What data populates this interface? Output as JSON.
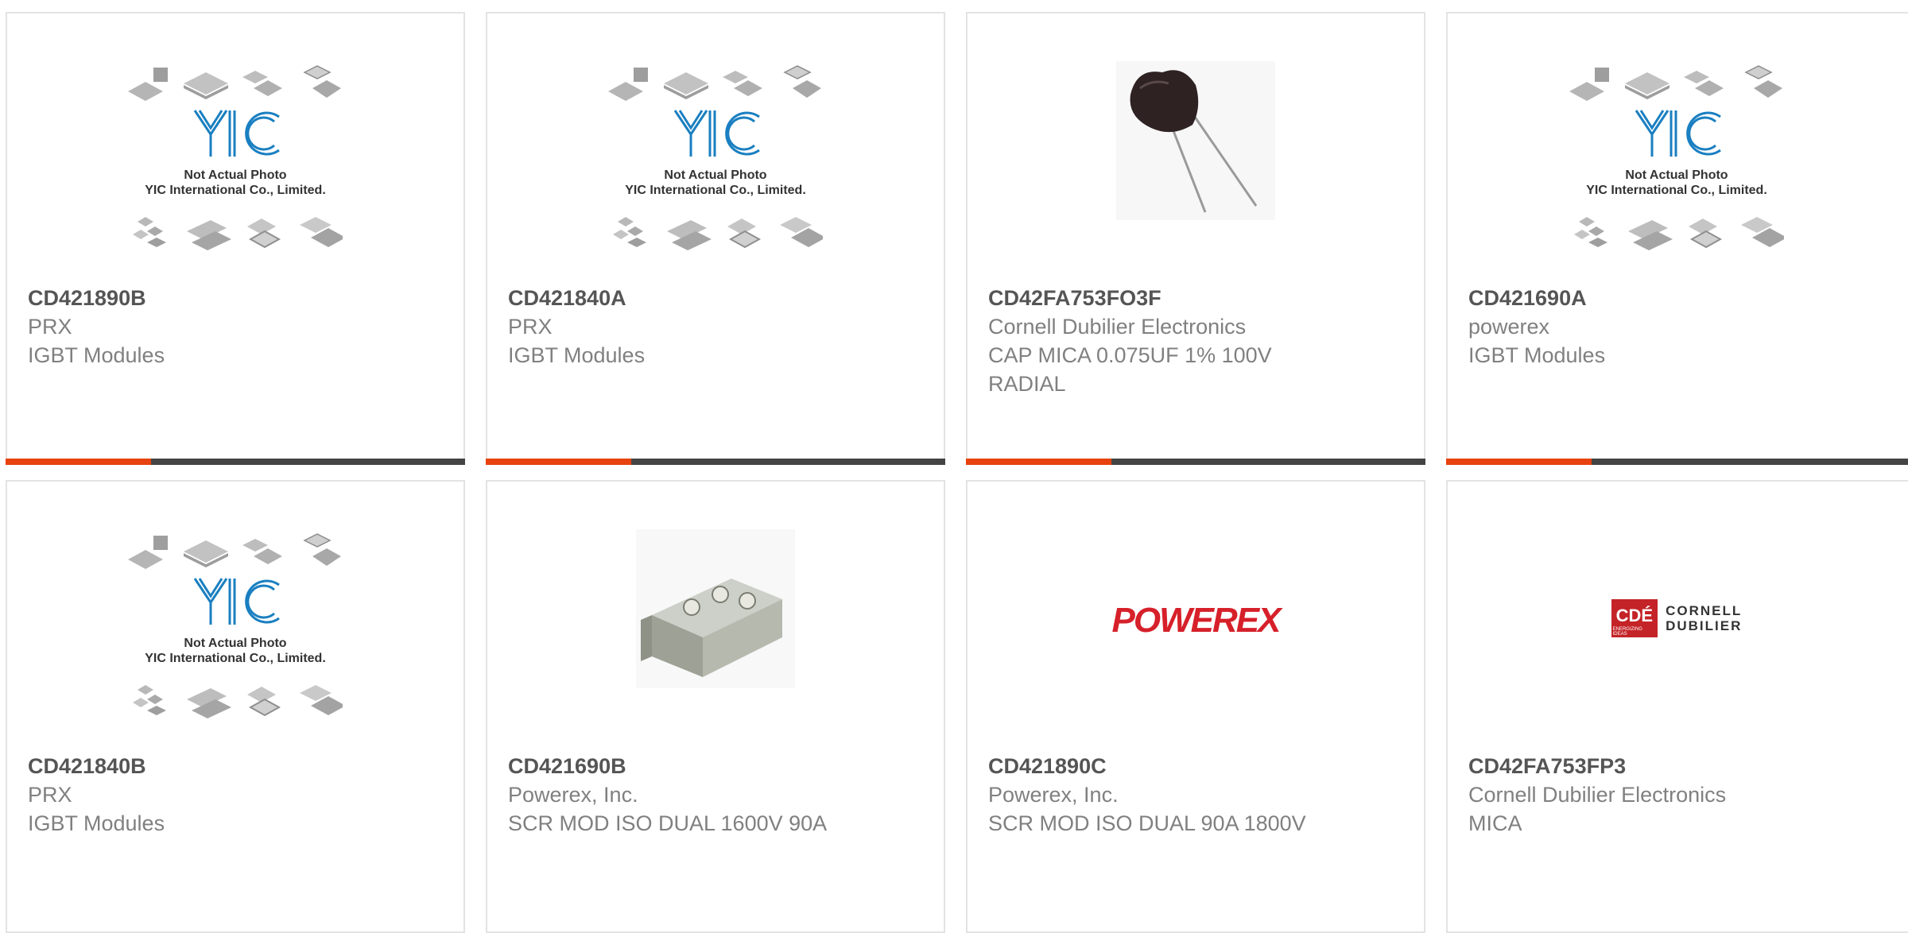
{
  "colors": {
    "accent": "#e8420e",
    "bar": "#444444",
    "yic_blue": "#1a7fc1",
    "powerex_red": "#d6202a",
    "cde_red": "#c42327"
  },
  "placeholder": {
    "line1": "Not Actual Photo",
    "line2": "YIC International Co., Limited."
  },
  "powerex_logo_text": "POWEREX",
  "cde_logo": {
    "badge": "CDÉ",
    "line1": "CORNELL",
    "line2": "DUBILIER",
    "tagline": "ENERGIZING IDEAS"
  },
  "products": [
    {
      "part": "CD421890B",
      "maker": "PRX",
      "desc1": "IGBT Modules",
      "desc2": "",
      "image": "yic-placeholder"
    },
    {
      "part": "CD421840A",
      "maker": "PRX",
      "desc1": "IGBT Modules",
      "desc2": "",
      "image": "yic-placeholder"
    },
    {
      "part": "CD42FA753FO3F",
      "maker": "Cornell Dubilier Electronics",
      "desc1": "CAP MICA 0.075UF 1% 100V",
      "desc2": "RADIAL",
      "image": "mica-capacitor-photo"
    },
    {
      "part": "CD421690A",
      "maker": "powerex",
      "desc1": "IGBT Modules",
      "desc2": "",
      "image": "yic-placeholder"
    },
    {
      "part": "CD421840B",
      "maker": "PRX",
      "desc1": "IGBT Modules",
      "desc2": "",
      "image": "yic-placeholder"
    },
    {
      "part": "CD421690B",
      "maker": "Powerex, Inc.",
      "desc1": "SCR MOD ISO DUAL 1600V 90A",
      "desc2": "",
      "image": "scr-module-photo"
    },
    {
      "part": "CD421890C",
      "maker": "Powerex, Inc.",
      "desc1": "SCR MOD ISO DUAL 90A 1800V",
      "desc2": "",
      "image": "powerex-logo"
    },
    {
      "part": "CD42FA753FP3",
      "maker": "Cornell Dubilier Electronics",
      "desc1": "MICA",
      "desc2": "",
      "image": "cornell-dubilier-logo"
    }
  ]
}
